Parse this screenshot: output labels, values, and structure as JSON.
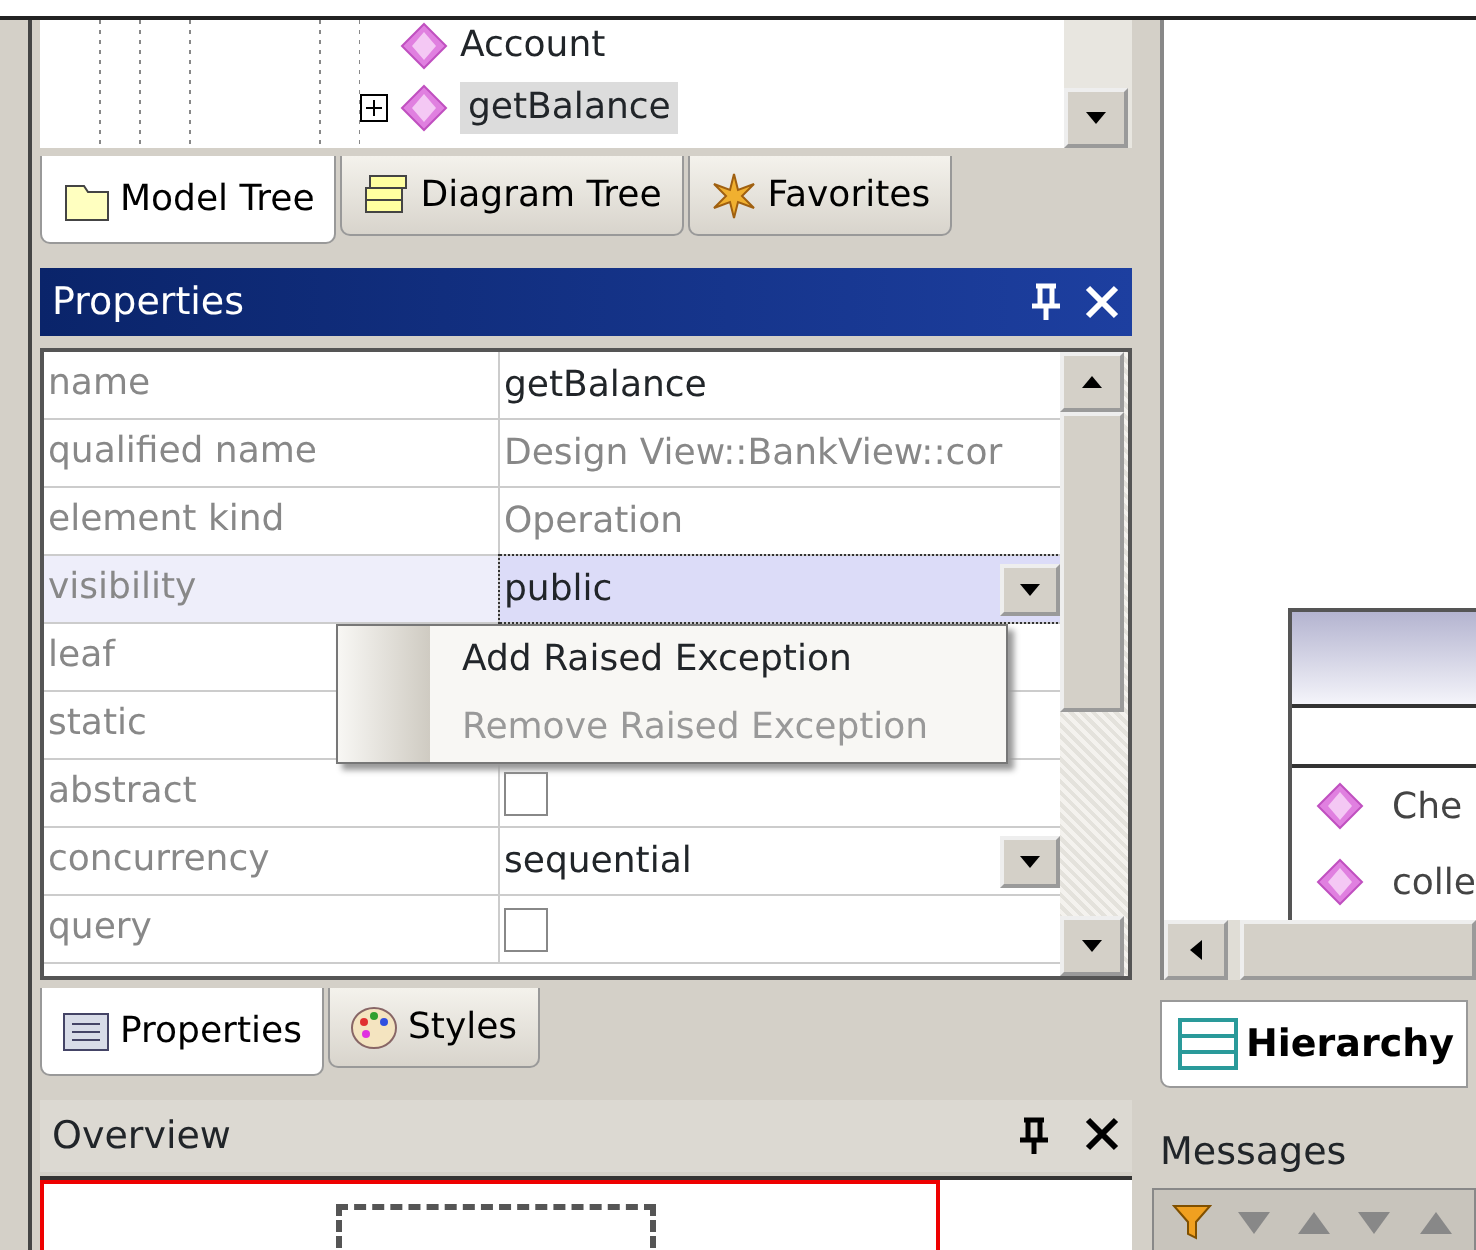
{
  "model_tree": {
    "items": [
      {
        "label": "Account",
        "expandable": false,
        "selected": false
      },
      {
        "label": "getBalance",
        "expandable": true,
        "selected": true
      }
    ]
  },
  "tree_tabs": [
    {
      "label": "Model Tree",
      "selected": true
    },
    {
      "label": "Diagram Tree",
      "selected": false
    },
    {
      "label": "Favorites",
      "selected": false
    }
  ],
  "properties": {
    "title": "Properties",
    "rows": [
      {
        "label": "name",
        "kind": "text",
        "value": "getBalance",
        "selected": false
      },
      {
        "label": "qualified name",
        "kind": "readonly",
        "value": "Design View::BankView::cor",
        "selected": false
      },
      {
        "label": "element kind",
        "kind": "readonly",
        "value": "Operation",
        "selected": false
      },
      {
        "label": "visibility",
        "kind": "combo",
        "value": "public",
        "selected": true
      },
      {
        "label": "leaf",
        "kind": "blank",
        "selected": false
      },
      {
        "label": "static",
        "kind": "blank",
        "selected": false
      },
      {
        "label": "abstract",
        "kind": "check",
        "checked": false,
        "selected": false
      },
      {
        "label": "concurrency",
        "kind": "combo",
        "value": "sequential",
        "selected": false
      },
      {
        "label": "query",
        "kind": "check",
        "checked": false,
        "selected": false
      }
    ]
  },
  "context_menu": [
    {
      "label": "Add Raised Exception",
      "disabled": false
    },
    {
      "label": "Remove Raised Exception",
      "disabled": true
    }
  ],
  "bottom_tabs": [
    {
      "label": "Properties",
      "selected": true
    },
    {
      "label": "Styles",
      "selected": false
    }
  ],
  "overview": {
    "title": "Overview"
  },
  "diagram": {
    "operations": [
      "Che",
      "colle"
    ]
  },
  "hierarchy_tab": {
    "label": "Hierarchy"
  },
  "messages": {
    "title": "Messages"
  }
}
